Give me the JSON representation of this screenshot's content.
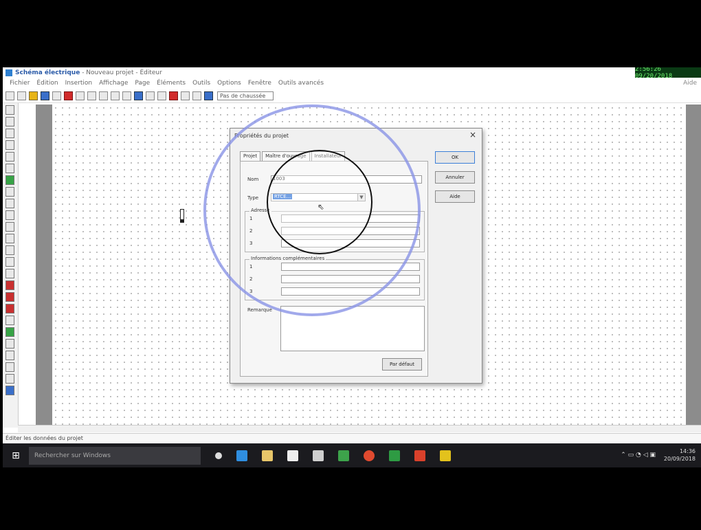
{
  "window": {
    "app_name": "Schéma électrique",
    "title_rest": "- Nouveau projet - Éditeur",
    "clock": "2:56:26 09/20/2018"
  },
  "menu": {
    "items": [
      "Fichier",
      "Édition",
      "Insertion",
      "Affichage",
      "Page",
      "Éléments",
      "Outils",
      "Options",
      "Fenêtre",
      "Outils avancés"
    ],
    "help": "Aide"
  },
  "toolbar": {
    "zoom_select": "Pas de chaussée"
  },
  "dialog": {
    "title": "Propriétés du projet",
    "close": "×",
    "tabs": [
      "Projet",
      "Maître d'ouvrage",
      "Installateur"
    ],
    "nom_label": "Nom",
    "nom_value": "1003",
    "type_label": "Type",
    "type_value": "RTCE...",
    "adresse_label": "Adresse",
    "info_label": "Informations complémentaires",
    "rows": [
      "1",
      "2",
      "3"
    ],
    "remarque_label": "Remarque",
    "ok": "OK",
    "annuler": "Annuler",
    "aide": "Aide",
    "par_defaut": "Par défaut"
  },
  "statusbar": {
    "text": "Éditer les données du projet"
  },
  "taskbar": {
    "search_placeholder": "Rechercher sur Windows",
    "time": "14:36",
    "date": "20/09/2018"
  }
}
